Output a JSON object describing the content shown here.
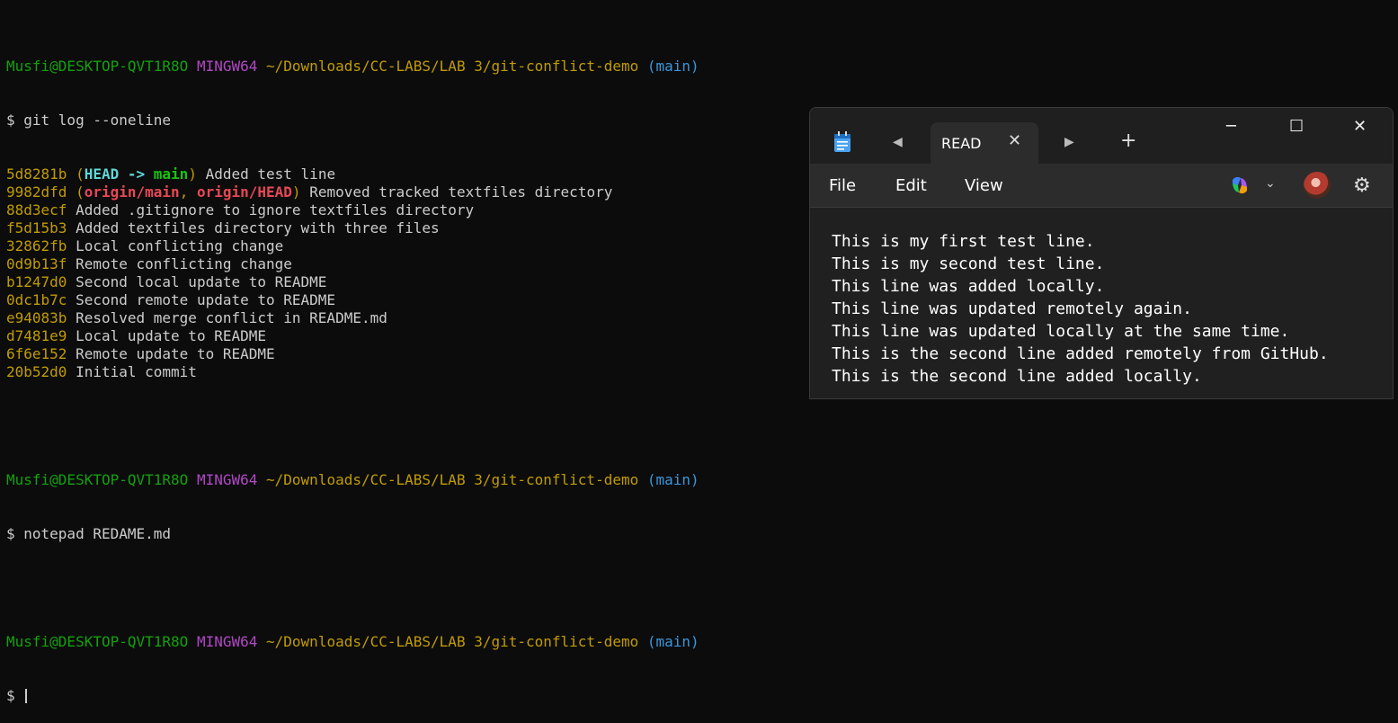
{
  "terminal": {
    "prompt1": {
      "user": "Musfi@DESKTOP-QVT1R8O",
      "env": "MINGW64",
      "path": "~/Downloads/CC-LABS/LAB 3/git-conflict-demo",
      "branch": "(main)"
    },
    "cmd1": "$ git log --oneline",
    "log": [
      {
        "hash": "5d8281b",
        "refs": [
          {
            "text": "HEAD -> ",
            "color": "cyan"
          },
          {
            "text": "main",
            "color": "green"
          }
        ],
        "msg": " Added test line"
      },
      {
        "hash": "9982dfd",
        "refs": [
          {
            "text": "origin/main",
            "color": "red"
          },
          {
            "text": ", ",
            "color": "yellow"
          },
          {
            "text": "origin/HEAD",
            "color": "red"
          }
        ],
        "msg": " Removed tracked textfiles directory"
      },
      {
        "hash": "88d3ecf",
        "msg": "Added .gitignore to ignore textfiles directory"
      },
      {
        "hash": "f5d15b3",
        "msg": "Added textfiles directory with three files"
      },
      {
        "hash": "32862fb",
        "msg": "Local conflicting change"
      },
      {
        "hash": "0d9b13f",
        "msg": "Remote conflicting change"
      },
      {
        "hash": "b1247d0",
        "msg": "Second local update to README"
      },
      {
        "hash": "0dc1b7c",
        "msg": "Second remote update to README"
      },
      {
        "hash": "e94083b",
        "msg": "Resolved merge conflict in README.md"
      },
      {
        "hash": "d7481e9",
        "msg": "Local update to README"
      },
      {
        "hash": "6f6e152",
        "msg": "Remote update to README"
      },
      {
        "hash": "20b52d0",
        "msg": "Initial commit"
      }
    ],
    "cmd2": "$ notepad REDAME.md",
    "cmd3": "$ "
  },
  "notepad": {
    "tab_title": "READ",
    "tab_close": "✕",
    "nav_prev": "◀",
    "nav_next": "▶",
    "new_tab": "+",
    "minimize": "─",
    "maximize": "☐",
    "close": "✕",
    "menu": {
      "file": "File",
      "edit": "Edit",
      "view": "View"
    },
    "chevron": "⌄",
    "gear": "⚙",
    "lines": [
      "This is my first test line.",
      "This is my second test line.",
      "This line was added locally.",
      "This line was updated remotely again.",
      "This line was updated locally at the same time.",
      "This is the second line added remotely from GitHub.",
      "This is the second line added locally."
    ]
  },
  "colors": {
    "bg": "#0c0c0c",
    "green": "#13a10e",
    "magenta": "#b148c6",
    "yellow": "#c19c00",
    "cyan": "#3a96dd",
    "red": "#e74856"
  }
}
